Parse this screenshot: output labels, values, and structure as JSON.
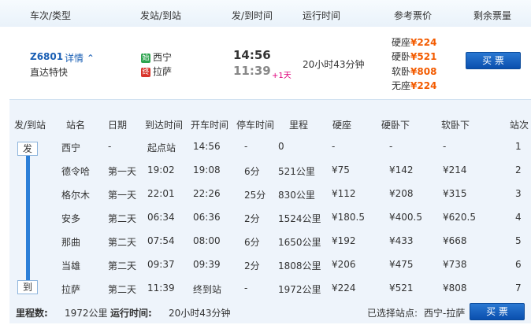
{
  "header": {
    "col_train": "车次/类型",
    "col_station": "发站/到站",
    "col_time": "发/到时间",
    "col_duration": "运行时间",
    "col_price": "参考票价",
    "col_tickets": "剩余票量"
  },
  "train": {
    "number": "Z6801",
    "detail_label": "详情",
    "type": "直达特快",
    "from_badge": "始",
    "from_station": "西宁",
    "to_badge": "终",
    "to_station": "拉萨",
    "depart_time": "14:56",
    "arrive_time": "11:39",
    "day_offset": "+1天",
    "duration": "20小时43分钟",
    "prices": [
      {
        "label": "硬座",
        "value": "¥224"
      },
      {
        "label": "硬卧",
        "value": "¥521"
      },
      {
        "label": "软卧",
        "value": "¥808"
      },
      {
        "label": "无座",
        "value": "¥224"
      }
    ],
    "buy_label": "买 票",
    "colors": {
      "start_badge": "#2ea44f",
      "end_badge": "#d9342b",
      "price": "#f35b00",
      "link": "#1a5fb4"
    }
  },
  "stops_header": {
    "dep_arr": "发/到站",
    "station": "站名",
    "date": "日期",
    "arrive": "到达时间",
    "depart": "开车时间",
    "stay": "停车时间",
    "distance": "里程",
    "hard_seat": "硬座",
    "hard_sleeper": "硬卧下",
    "soft_sleeper": "软卧下",
    "seq": "站次"
  },
  "flags": {
    "start": "发",
    "end": "到"
  },
  "stops": [
    {
      "station": "西宁",
      "date": "-",
      "arrive": "起点站",
      "depart": "14:56",
      "stay": "-",
      "distance": "0",
      "seat": "-",
      "hard": "-",
      "soft": "-",
      "seq": "1"
    },
    {
      "station": "德令哈",
      "date": "第一天",
      "arrive": "19:02",
      "depart": "19:08",
      "stay": "6分",
      "distance": "521公里",
      "seat": "¥75",
      "hard": "¥142",
      "soft": "¥214",
      "seq": "2"
    },
    {
      "station": "格尔木",
      "date": "第一天",
      "arrive": "22:01",
      "depart": "22:26",
      "stay": "25分",
      "distance": "830公里",
      "seat": "¥112",
      "hard": "¥208",
      "soft": "¥315",
      "seq": "3"
    },
    {
      "station": "安多",
      "date": "第二天",
      "arrive": "06:34",
      "depart": "06:36",
      "stay": "2分",
      "distance": "1524公里",
      "seat": "¥180.5",
      "hard": "¥400.5",
      "soft": "¥620.5",
      "seq": "4"
    },
    {
      "station": "那曲",
      "date": "第二天",
      "arrive": "07:54",
      "depart": "08:00",
      "stay": "6分",
      "distance": "1650公里",
      "seat": "¥192",
      "hard": "¥433",
      "soft": "¥668",
      "seq": "5"
    },
    {
      "station": "当雄",
      "date": "第二天",
      "arrive": "09:37",
      "depart": "09:39",
      "stay": "2分",
      "distance": "1808公里",
      "seat": "¥206",
      "hard": "¥475",
      "soft": "¥738",
      "seq": "6"
    },
    {
      "station": "拉萨",
      "date": "第二天",
      "arrive": "11:39",
      "depart": "终到站",
      "stay": "-",
      "distance": "1972公里",
      "seat": "¥224",
      "hard": "¥521",
      "soft": "¥808",
      "seq": "7"
    }
  ],
  "footer": {
    "distance_label": "里程数:",
    "distance_value": "1972公里",
    "runtime_label": "运行时间:",
    "runtime_value": "20小时43分钟",
    "selected_label": "已选择站点:",
    "selected_value": "西宁-拉萨",
    "buy_label": "买 票"
  }
}
